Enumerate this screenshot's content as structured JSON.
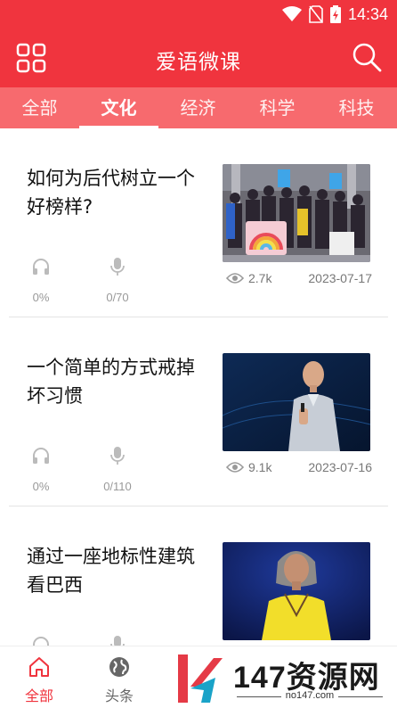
{
  "status_bar": {
    "time": "14:34"
  },
  "header": {
    "title": "爱语微课"
  },
  "tabs": [
    {
      "label": "全部"
    },
    {
      "label": "文化",
      "active": true
    },
    {
      "label": "经济"
    },
    {
      "label": "科学"
    },
    {
      "label": "科技"
    }
  ],
  "articles": [
    {
      "title": "如何为后代树立一个好榜样?",
      "listen": "0%",
      "speak": "0/70",
      "views": "2.7k",
      "date": "2023-07-17"
    },
    {
      "title": "一个简单的方式戒掉坏习惯",
      "listen": "0%",
      "speak": "0/110",
      "views": "9.1k",
      "date": "2023-07-16"
    },
    {
      "title": "通过一座地标性建筑看巴西",
      "listen": "",
      "speak": "",
      "views": "",
      "date": ""
    }
  ],
  "bottom_nav": [
    {
      "label": "全部",
      "icon": "home-icon",
      "active": true
    },
    {
      "label": "头条",
      "icon": "globe-icon"
    }
  ],
  "watermark": {
    "text": "147资源网",
    "sub": "no147.com"
  },
  "colors": {
    "brand_red": "#f0343e",
    "tab_bar": "#f76a6e"
  }
}
